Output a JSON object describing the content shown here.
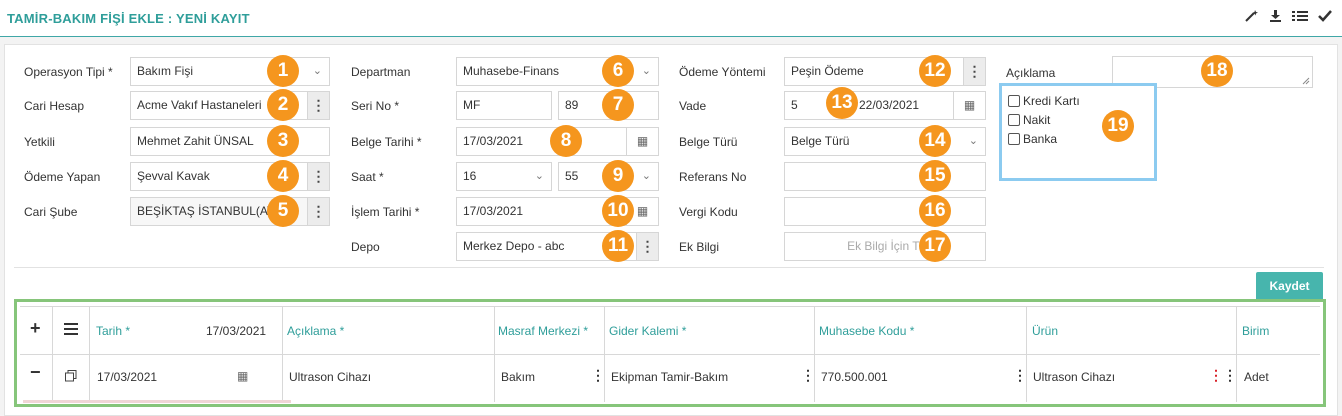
{
  "header": {
    "title": "TAMİR-BAKIM FİŞİ EKLE : YENİ KAYIT"
  },
  "form": {
    "operasyon_tipi": {
      "label": "Operasyon Tipi *",
      "value": "Bakım Fişi"
    },
    "cari_hesap": {
      "label": "Cari Hesap",
      "value": "Acme Vakıf Hastaneleri"
    },
    "yetkili": {
      "label": "Yetkili",
      "value": "Mehmet Zahit ÜNSAL"
    },
    "odeme_yapan": {
      "label": "Ödeme Yapan",
      "value": "Şevval Kavak"
    },
    "cari_sube": {
      "label": "Cari Şube",
      "value": "BEŞİKTAŞ İSTANBUL(AV"
    },
    "departman": {
      "label": "Departman",
      "value": "Muhasebe-Finans"
    },
    "seri_no": {
      "label": "Seri No *",
      "value1": "MF",
      "value2": "89"
    },
    "belge_tarihi": {
      "label": "Belge Tarihi *",
      "value": "17/03/2021"
    },
    "saat": {
      "label": "Saat *",
      "hour": "16",
      "minute": "55"
    },
    "islem_tarihi": {
      "label": "İşlem Tarihi *",
      "value": "17/03/2021"
    },
    "depo": {
      "label": "Depo",
      "value": "Merkez Depo - abc"
    },
    "odeme_yontemi": {
      "label": "Ödeme Yöntemi",
      "value": "Peşin Ödeme"
    },
    "vade": {
      "label": "Vade",
      "days": "5",
      "date": "22/03/2021"
    },
    "belge_turu": {
      "label": "Belge Türü",
      "value": "Belge Türü"
    },
    "referans_no": {
      "label": "Referans No",
      "value": ""
    },
    "vergi_kodu": {
      "label": "Vergi Kodu",
      "value": ""
    },
    "ek_bilgi": {
      "label": "Ek Bilgi",
      "placeholder": "Ek Bilgi İçin Tı"
    },
    "aciklama": {
      "label": "Açıklama",
      "value": ""
    },
    "payment_options": [
      {
        "label": "Kredi Kartı",
        "checked": false
      },
      {
        "label": "Nakit",
        "checked": false
      },
      {
        "label": "Banka",
        "checked": false
      }
    ]
  },
  "badges": [
    "1",
    "2",
    "3",
    "4",
    "5",
    "6",
    "7",
    "8",
    "9",
    "10",
    "11",
    "12",
    "13",
    "14",
    "15",
    "16",
    "17",
    "18",
    "19"
  ],
  "actions": {
    "save_label": "Kaydet"
  },
  "grid": {
    "headers": {
      "add": "+",
      "tarih": "Tarih *",
      "tarih_value": "17/03/2021",
      "aciklama": "Açıklama *",
      "masraf_merkezi": "Masraf Merkezi *",
      "gider_kalemi": "Gider Kalemi *",
      "muhasebe_kodu": "Muhasebe Kodu *",
      "urun": "Ürün",
      "birim": "Birim"
    },
    "rows": [
      {
        "remove": "−",
        "tarih": "17/03/2021",
        "aciklama": "Ultrason Cihazı",
        "masraf_merkezi": "Bakım",
        "gider_kalemi": "Ekipman Tamir-Bakım",
        "muhasebe_kodu": "770.500.001",
        "urun": "Ultrason Cihazı",
        "birim": "Adet"
      }
    ]
  },
  "colors": {
    "accent": "#2f9e9a",
    "badge": "#f5961e",
    "save": "#47b5ad",
    "highlight_blue": "#8ccbf0",
    "highlight_green": "#86c57a"
  }
}
